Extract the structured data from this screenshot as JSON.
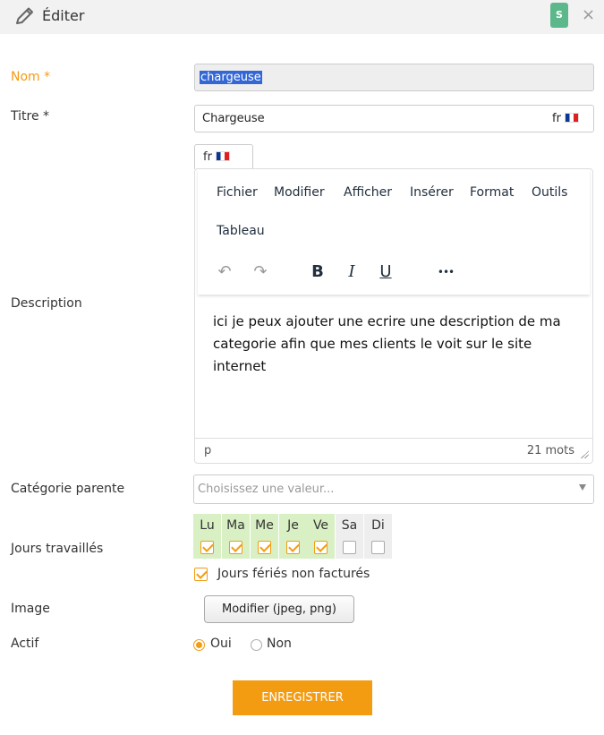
{
  "header": {
    "title": "Éditer",
    "badge": "S",
    "close": "×"
  },
  "fields": {
    "nom": {
      "label": "Nom *",
      "value": "chargeuse"
    },
    "titre": {
      "label": "Titre *",
      "value": "Chargeuse",
      "lang": "fr"
    },
    "description": {
      "label": "Description",
      "tab_lang": "fr",
      "menu": [
        "Fichier",
        "Modifier",
        "Afficher",
        "Insérer",
        "Format",
        "Outils",
        "Tableau"
      ],
      "tools": {
        "undo": "↶",
        "redo": "↷",
        "bold": "B",
        "italic": "I",
        "underline": "U",
        "more": "•••"
      },
      "content": "ici je peux ajouter une ecrire une description de ma categorie afin que mes clients le voit sur le site internet",
      "status_path": "p",
      "word_count": "21 mots"
    },
    "categorie": {
      "label": "Catégorie parente",
      "placeholder": "Choisissez une valeur..."
    },
    "jours": {
      "label": "Jours travaillés",
      "days": [
        {
          "name": "Lu",
          "checked": true
        },
        {
          "name": "Ma",
          "checked": true
        },
        {
          "name": "Me",
          "checked": true
        },
        {
          "name": "Je",
          "checked": true
        },
        {
          "name": "Ve",
          "checked": true
        },
        {
          "name": "Sa",
          "checked": false
        },
        {
          "name": "Di",
          "checked": false
        }
      ],
      "holidays_label": "Jours fériés non facturés",
      "holidays_checked": true
    },
    "image": {
      "label": "Image",
      "button": "Modifier (jpeg, png)"
    },
    "actif": {
      "label": "Actif",
      "yes": "Oui",
      "no": "Non",
      "selected": "Oui"
    }
  },
  "save_label": "ENREGISTRER",
  "colors": {
    "accent": "#f39c12",
    "badge": "#5cb88a",
    "selection": "#3367d6",
    "workday": "#d8f0c4"
  }
}
